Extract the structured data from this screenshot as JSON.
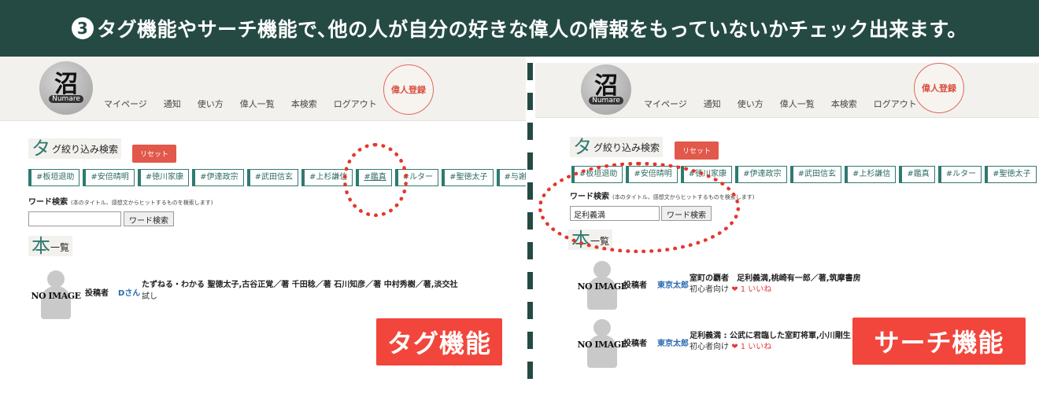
{
  "banner": {
    "num": "3",
    "text": "タグ機能やサーチ機能で､他の人が自分の好きな偉人の情報をもっていないかチェック出来ます。"
  },
  "header": {
    "logo_kanji": "沼",
    "logo_romaji": "Numare",
    "nav": [
      "マイページ",
      "通知",
      "使い方",
      "偉人一覧",
      "本検索",
      "ログアウト"
    ],
    "register": "偉人登録"
  },
  "search": {
    "tag_title_big": "タ",
    "tag_title_small": "グ絞り込み検索",
    "reset": "リセット",
    "tags": [
      "#板垣退助",
      "#安倍晴明",
      "#徳川家康",
      "#伊達政宗",
      "#武田信玄",
      "#上杉謙信",
      "#鑑真",
      "#ルター",
      "#聖徳太子",
      "#与謝"
    ],
    "word_label": "ワード検索",
    "word_note": "(本のタイトル、感想文からヒットするものを検索します)",
    "word_button": "ワード検索",
    "list_title_big": "本",
    "list_title_small": "一覧"
  },
  "left_panel": {
    "input_value": "",
    "book": {
      "noimage": "NO IMAGE",
      "poster_label": "投稿者",
      "poster": "Dさん",
      "title": "たずねる・わかる 聖徳太子,古谷正覚／著 千田稔／著 石川知彦／著 中村秀樹／著,淡交社",
      "sub": "試し"
    },
    "callout": "タグ機能"
  },
  "right_panel": {
    "input_value": "足利義満",
    "books": [
      {
        "noimage": "NO IMAGE",
        "poster_label": "投稿者",
        "poster": "東京太郎",
        "title": "室町の覇者　足利義満,桃崎有一郎／著,筑摩書房",
        "level": "初心者向け",
        "likes": "1 いいね"
      },
      {
        "noimage": "NO IMAGE",
        "poster_label": "投稿者",
        "poster": "東京太郎",
        "title": "足利義満 : 公武に君臨した室町将軍,小川剛生",
        "level": "初心者向け",
        "likes": "1 いいね"
      }
    ],
    "callout": "サーチ機能"
  },
  "colors": {
    "banner": "#254a44",
    "accent": "#2e7a70",
    "red": "#e5362d"
  },
  "icons": {
    "heart": "heart-icon",
    "placeholder": "person-placeholder-icon"
  }
}
